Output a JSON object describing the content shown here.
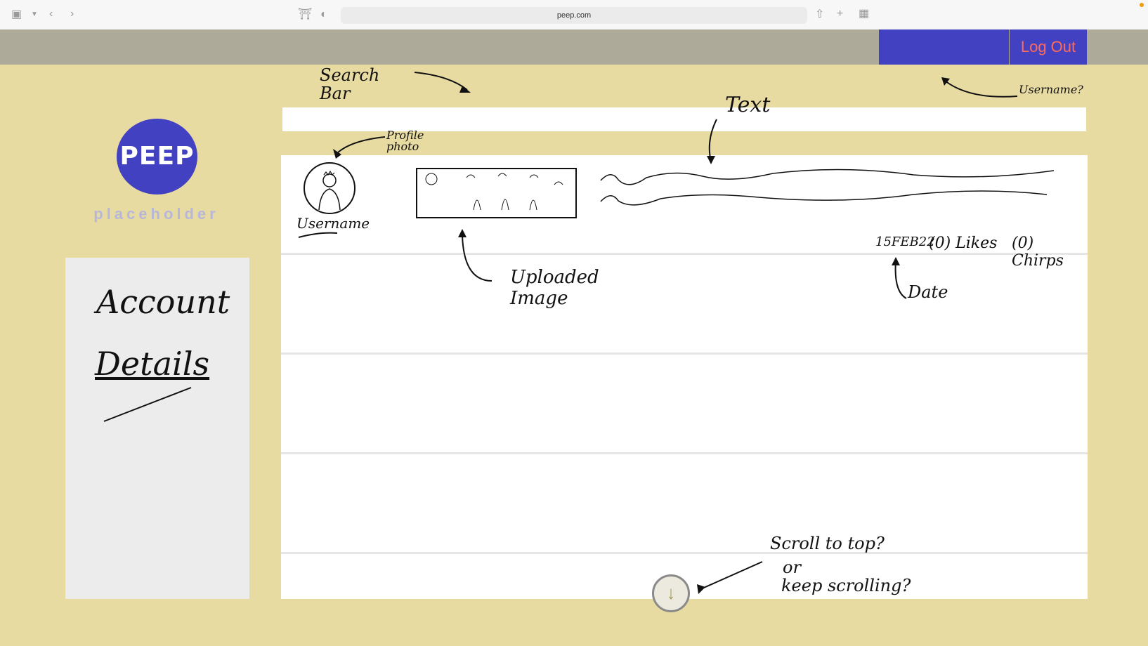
{
  "browser": {
    "url": "peep.com",
    "icons": [
      "sidebar-icon",
      "chevron-down-icon",
      "back-icon",
      "forward-icon",
      "shield-icon",
      "privacy-icon",
      "share-icon",
      "new-tab-icon",
      "tab-overview-icon"
    ]
  },
  "header": {
    "logout_label": "Log Out",
    "accent_color": "#4141c2",
    "logout_color": "#ff6b5b"
  },
  "brand": {
    "logo_text": "PEEP",
    "name": "placeholder"
  },
  "sidebar": {
    "items": [
      "Account",
      "Details"
    ]
  },
  "post": {
    "username": "Username",
    "date": "15FEB22",
    "likes": "(0) Likes",
    "chirps": "(0) Chirps"
  },
  "annotations": {
    "search_bar": "Search Bar",
    "profile_photo": "Profile photo",
    "text": "Text",
    "username_q": "Username?",
    "uploaded_image": "Uploaded Image",
    "date": "Date",
    "scroll_q1": "Scroll to top?",
    "scroll_q2": "or",
    "scroll_q3": "keep scrolling?"
  },
  "colors": {
    "page_bg": "#e8dba2",
    "header_bg": "#adaa99",
    "panel_bg": "#ececec"
  }
}
